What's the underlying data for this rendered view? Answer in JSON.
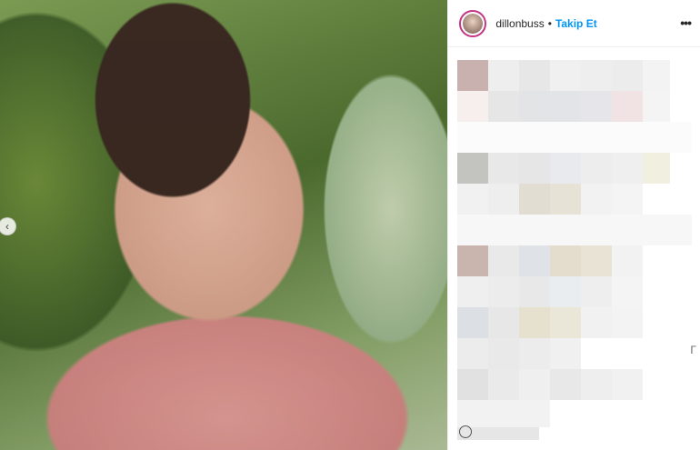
{
  "post": {
    "author": {
      "username": "dillonbuss",
      "follow_label": "Takip Et",
      "separator": "•"
    },
    "more_label": "•••",
    "carousel_prev_label": "‹",
    "side_glyph": "Γ"
  },
  "colors": {
    "accent_blue": "#0095f6",
    "story_ring": "#c13584",
    "text": "#262626"
  }
}
